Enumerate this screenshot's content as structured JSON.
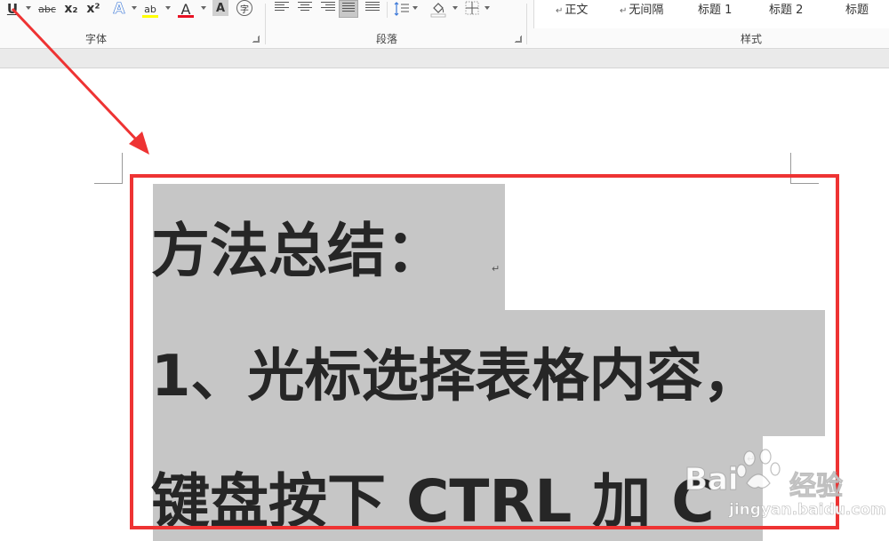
{
  "ribbon": {
    "font_group": {
      "label": "字体",
      "underline": "U",
      "strikethrough": "abc",
      "subscript": "x₂",
      "superscript": "x²",
      "text_effect": "A",
      "highlight": "ab",
      "font_color": "A",
      "char_shading": "A",
      "enclose_char": "字"
    },
    "paragraph_group": {
      "label": "段落"
    },
    "styles_group": {
      "label": "样式",
      "items": [
        "正文",
        "无间隔",
        "标题 1",
        "标题 2",
        "标题"
      ]
    }
  },
  "document": {
    "lines": [
      "方法总结：",
      "1、光标选择表格内容，",
      "键盘按下 CTRL 加 C"
    ]
  },
  "watermark": {
    "brand": "Bai",
    "brand_suffix": "经验",
    "url": "jingyan.baidu.com"
  },
  "colors": {
    "highlight_yellow": "#ffff00",
    "font_color_red": "#e81123",
    "selection_gray": "#c6c6c6",
    "annotation_red": "#ee3333"
  }
}
